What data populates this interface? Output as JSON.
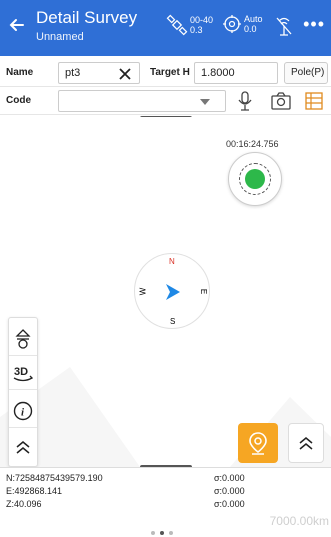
{
  "header": {
    "title": "Detail Survey",
    "subtitle": "Unnamed",
    "sat_status": {
      "top": "00-40",
      "bottom": "0.3"
    },
    "diff_status": {
      "top": "Auto",
      "bottom": "0.0"
    },
    "more_label": "•••"
  },
  "form": {
    "name_label": "Name",
    "name_value": "pt3",
    "target_label": "Target H",
    "target_value": "1.8000",
    "pole_button": "Pole(P)",
    "code_label": "Code",
    "code_value": ""
  },
  "map": {
    "timer": "00:16:24.756",
    "compass": {
      "n": "N",
      "s": "S",
      "w": "W",
      "e": "E"
    },
    "tool_3d": "3D"
  },
  "coords": {
    "n": "N:72584875439579.190",
    "e": "E:492868.141",
    "z": "Z:40.096",
    "sigma_n": "σ:0.000",
    "sigma_e": "σ:0.000",
    "sigma_z": "σ:0.000",
    "scale": "7000.00km"
  },
  "colors": {
    "primary": "#2f6fd6",
    "fab": "#f6a623",
    "gps_fix": "#2db84a",
    "compass_north": "#d93025",
    "arrow": "#1e88e5"
  },
  "pager": {
    "count": 3,
    "active": 1
  }
}
